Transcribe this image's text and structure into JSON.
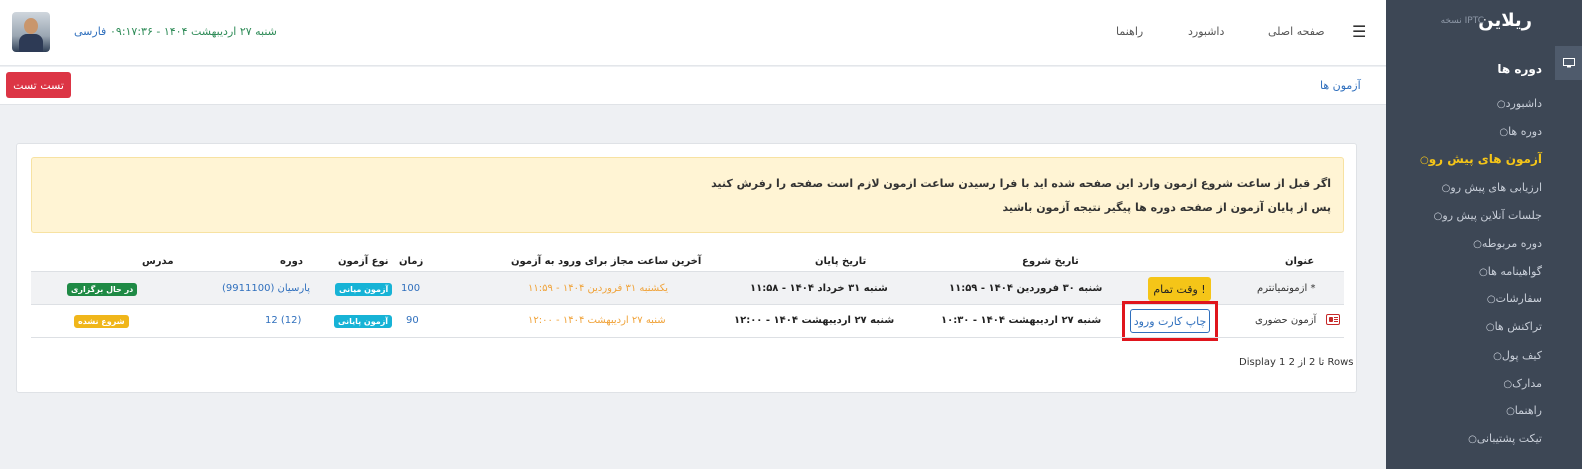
{
  "sidebar": {
    "logo": "ریلاین",
    "version": "نسخه IPTC",
    "heading": "دوره ها",
    "items": [
      {
        "label": "داشبورد"
      },
      {
        "label": "دوره ها"
      },
      {
        "label": "آزمون های پیش رو",
        "active": true
      },
      {
        "label": "ارزیابی های پیش رو"
      },
      {
        "label": "جلسات آنلاین پیش رو"
      },
      {
        "label": "دوره مربوطه"
      },
      {
        "label": "گواهینامه ها"
      },
      {
        "label": "سفارشات"
      },
      {
        "label": "تراکنش ها"
      },
      {
        "label": "کیف پول"
      },
      {
        "label": "مدارک"
      },
      {
        "label": "راهنما"
      },
      {
        "label": "تیکت پشتیبانی"
      }
    ]
  },
  "topbar": {
    "nav": [
      "صفحه اصلی",
      "داشبورد",
      "راهنما"
    ],
    "language": "فارسی",
    "datetime": "شنبه ۲۷ اردیبهشت ۱۴۰۴ - ۰۹:۱۷:۳۶"
  },
  "breadcrumb": "آزمون ها",
  "test_button": "تست تست",
  "alert": {
    "line1": "اگر قبل از ساعت شروع ازمون وارد این صفحه شده اید با فرا رسیدن ساعت ازمون لازم است صفحه را رفرش کنید",
    "line2": "پس از پایان آزمون از صفحه دوره ها پیگیر نتیجه آزمون باشید"
  },
  "table": {
    "headers": {
      "title": "عنوان",
      "start": "تاریخ شروع",
      "end": "تاریخ پایان",
      "last_entry": "آخرین ساعت مجاز برای ورود به آزمون",
      "duration": "زمان",
      "type": "نوع آزمون",
      "course": "دوره",
      "teacher": "مدرس"
    },
    "rows": [
      {
        "title": "ازمونمیانترم *",
        "action": "وقت تمام !",
        "start": "شنبه ۳۰ فروردین ۱۴۰۴ - ۱۱:۵۹",
        "end": "شنبه ۳۱ خرداد ۱۴۰۴ - ۱۱:۵۸",
        "last_entry": "یکشنبه ۳۱ فروردین ۱۴۰۴ - ۱۱:۵۹",
        "duration": "100",
        "type": "آزمون میانی",
        "course": "پارسیان (9911100)",
        "status": "در حال برگزاری"
      },
      {
        "title": "آزمون حضوری",
        "action": "چاپ کارت ورود",
        "start": "شنبه ۲۷ اردیبهشت ۱۴۰۴ - ۱۰:۳۰",
        "end": "شنبه ۲۷ اردیبهشت ۱۴۰۴ - ۱۲:۰۰",
        "last_entry": "شنبه ۲۷ اردیبهشت ۱۴۰۴ - ۱۲:۰۰",
        "duration": "90",
        "type": "آزمون پایانی",
        "course": "12 (12)",
        "status": "شروع نشده"
      }
    ],
    "footer": "Display 1 تا 2 از 2 Rows"
  },
  "colors": {
    "sidebar_bg": "#3d4755",
    "active": "#f5c518",
    "danger": "#dc3545",
    "link": "#2f6fbd"
  }
}
